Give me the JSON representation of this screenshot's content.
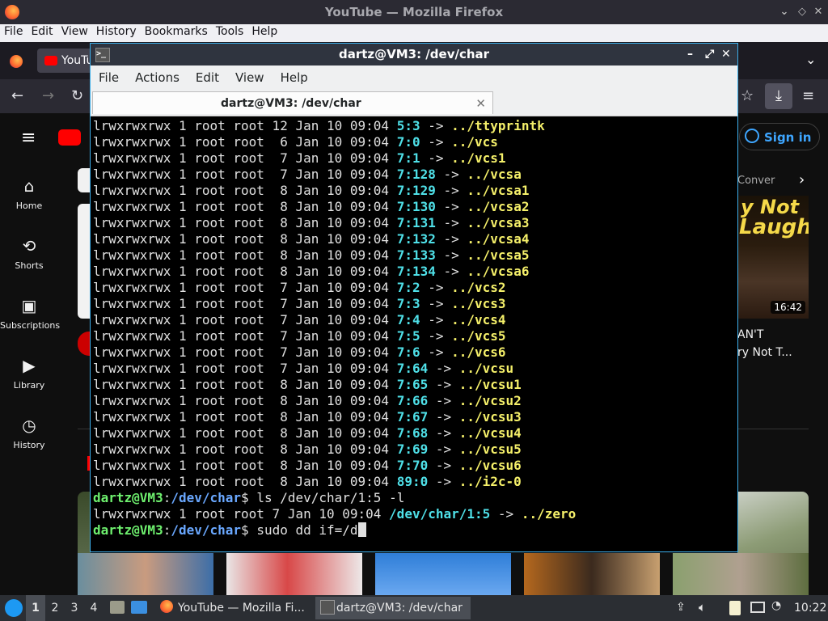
{
  "firefox": {
    "window_title": "YouTube — Mozilla Firefox",
    "menu": [
      "File",
      "Edit",
      "View",
      "History",
      "Bookmarks",
      "Tools",
      "Help"
    ],
    "tab_label": "YouTu"
  },
  "youtube": {
    "sidebar": [
      {
        "label": "Home",
        "icon": "home-icon"
      },
      {
        "label": "Shorts",
        "icon": "shorts-icon"
      },
      {
        "label": "Subscriptions",
        "icon": "subscriptions-icon"
      },
      {
        "label": "Library",
        "icon": "library-icon"
      },
      {
        "label": "History",
        "icon": "history-icon"
      }
    ],
    "sign_in": "Sign in",
    "chip_partial": "Conver",
    "thumb_text": [
      "y Not",
      "Laugh"
    ],
    "duration": "16:42",
    "video_title_line1": "AN'T",
    "video_title_line2": "ry Not T..."
  },
  "terminal": {
    "window_title": "dartz@VM3: /dev/char",
    "menu": [
      "File",
      "Actions",
      "Edit",
      "View",
      "Help"
    ],
    "tab_label": "dartz@VM3: /dev/char",
    "listing": [
      {
        "prefix": "lrwxrwxrwx 1 root root 12 Jan 10 09:04 ",
        "num": "5:3",
        "target": "../ttyprintk"
      },
      {
        "prefix": "lrwxrwxrwx 1 root root  6 Jan 10 09:04 ",
        "num": "7:0",
        "target": "../vcs"
      },
      {
        "prefix": "lrwxrwxrwx 1 root root  7 Jan 10 09:04 ",
        "num": "7:1",
        "target": "../vcs1"
      },
      {
        "prefix": "lrwxrwxrwx 1 root root  7 Jan 10 09:04 ",
        "num": "7:128",
        "target": "../vcsa"
      },
      {
        "prefix": "lrwxrwxrwx 1 root root  8 Jan 10 09:04 ",
        "num": "7:129",
        "target": "../vcsa1"
      },
      {
        "prefix": "lrwxrwxrwx 1 root root  8 Jan 10 09:04 ",
        "num": "7:130",
        "target": "../vcsa2"
      },
      {
        "prefix": "lrwxrwxrwx 1 root root  8 Jan 10 09:04 ",
        "num": "7:131",
        "target": "../vcsa3"
      },
      {
        "prefix": "lrwxrwxrwx 1 root root  8 Jan 10 09:04 ",
        "num": "7:132",
        "target": "../vcsa4"
      },
      {
        "prefix": "lrwxrwxrwx 1 root root  8 Jan 10 09:04 ",
        "num": "7:133",
        "target": "../vcsa5"
      },
      {
        "prefix": "lrwxrwxrwx 1 root root  8 Jan 10 09:04 ",
        "num": "7:134",
        "target": "../vcsa6"
      },
      {
        "prefix": "lrwxrwxrwx 1 root root  7 Jan 10 09:04 ",
        "num": "7:2",
        "target": "../vcs2"
      },
      {
        "prefix": "lrwxrwxrwx 1 root root  7 Jan 10 09:04 ",
        "num": "7:3",
        "target": "../vcs3"
      },
      {
        "prefix": "lrwxrwxrwx 1 root root  7 Jan 10 09:04 ",
        "num": "7:4",
        "target": "../vcs4"
      },
      {
        "prefix": "lrwxrwxrwx 1 root root  7 Jan 10 09:04 ",
        "num": "7:5",
        "target": "../vcs5"
      },
      {
        "prefix": "lrwxrwxrwx 1 root root  7 Jan 10 09:04 ",
        "num": "7:6",
        "target": "../vcs6"
      },
      {
        "prefix": "lrwxrwxrwx 1 root root  7 Jan 10 09:04 ",
        "num": "7:64",
        "target": "../vcsu"
      },
      {
        "prefix": "lrwxrwxrwx 1 root root  8 Jan 10 09:04 ",
        "num": "7:65",
        "target": "../vcsu1"
      },
      {
        "prefix": "lrwxrwxrwx 1 root root  8 Jan 10 09:04 ",
        "num": "7:66",
        "target": "../vcsu2"
      },
      {
        "prefix": "lrwxrwxrwx 1 root root  8 Jan 10 09:04 ",
        "num": "7:67",
        "target": "../vcsu3"
      },
      {
        "prefix": "lrwxrwxrwx 1 root root  8 Jan 10 09:04 ",
        "num": "7:68",
        "target": "../vcsu4"
      },
      {
        "prefix": "lrwxrwxrwx 1 root root  8 Jan 10 09:04 ",
        "num": "7:69",
        "target": "../vcsu5"
      },
      {
        "prefix": "lrwxrwxrwx 1 root root  8 Jan 10 09:04 ",
        "num": "7:70",
        "target": "../vcsu6"
      },
      {
        "prefix": "lrwxrwxrwx 1 root root  8 Jan 10 09:04 ",
        "num": "89:0",
        "target": "../i2c-0"
      }
    ],
    "prompt_user": "dartz@VM3",
    "prompt_sep": ":",
    "prompt_dir": "/dev/char",
    "prompt_end": "$ ",
    "cmd1": "ls /dev/char/1:5 -l",
    "result_prefix": "lrwxrwxrwx 1 root root 7 Jan 10 09:04 ",
    "result_path": "/dev/char/1:5",
    "result_target": "../zero",
    "cmd2": "sudo dd if=/d",
    "arrow": " -> "
  },
  "taskbar": {
    "workspaces": [
      "1",
      "2",
      "3",
      "4"
    ],
    "firefox_item": "YouTube — Mozilla Fi...",
    "terminal_item": "dartz@VM3: /dev/char",
    "clock": "10:22"
  }
}
